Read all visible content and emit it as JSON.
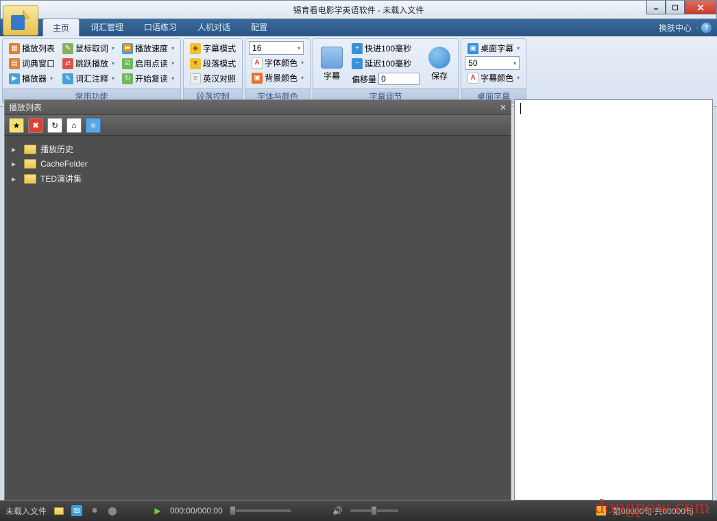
{
  "window": {
    "title": "锡育看电影学英语软件 - 未载入文件"
  },
  "menu": {
    "tabs": [
      "主页",
      "词汇管理",
      "口语练习",
      "人机对话",
      "配置"
    ],
    "skin": "换肤中心",
    "dd": "▾"
  },
  "ribbon": {
    "g1": {
      "label": "常用功能",
      "c": [
        [
          "播放列表",
          "鼠标取词",
          "播放速度"
        ],
        [
          "词典窗口",
          "跳跃播放",
          "启用点读"
        ],
        [
          "播放器",
          "词汇注释",
          "开始复读"
        ]
      ],
      "iconColors": [
        [
          "#e08030",
          "#88b060",
          "#4aa0d8"
        ],
        [
          "#e08030",
          "#e05048",
          "#70b858"
        ],
        [
          "#4aa0d8",
          "#4aa0d8",
          "#70b858"
        ]
      ]
    },
    "g2": {
      "label": "段落控制",
      "items": [
        "字幕模式",
        "段落模式",
        "英汉对照"
      ]
    },
    "g3": {
      "label": "字体与颜色",
      "fontsize": "16",
      "items": [
        "字体颜色",
        "背景颜色"
      ]
    },
    "g4": {
      "label": "字幕调节",
      "sub": "字幕",
      "fwd": "快进100毫秒",
      "back": "延迟100毫秒",
      "offset_label": "偏移量",
      "offset": "0",
      "save": "保存"
    },
    "g5": {
      "label": "桌面字幕",
      "desk": "桌面字幕",
      "size": "50",
      "color": "字幕颜色"
    }
  },
  "panel": {
    "title": "播放列表",
    "tree": [
      "播放历史",
      "CacheFolder",
      "TED演讲集"
    ]
  },
  "status": {
    "file": "未载入文件",
    "time": "000:00/000:00",
    "sentence_prefix": "第",
    "sentence_mid": "句  共",
    "sentence_suffix": "句",
    "cur": "00000",
    "total": "00000"
  },
  "watermark": "dongpow.com"
}
